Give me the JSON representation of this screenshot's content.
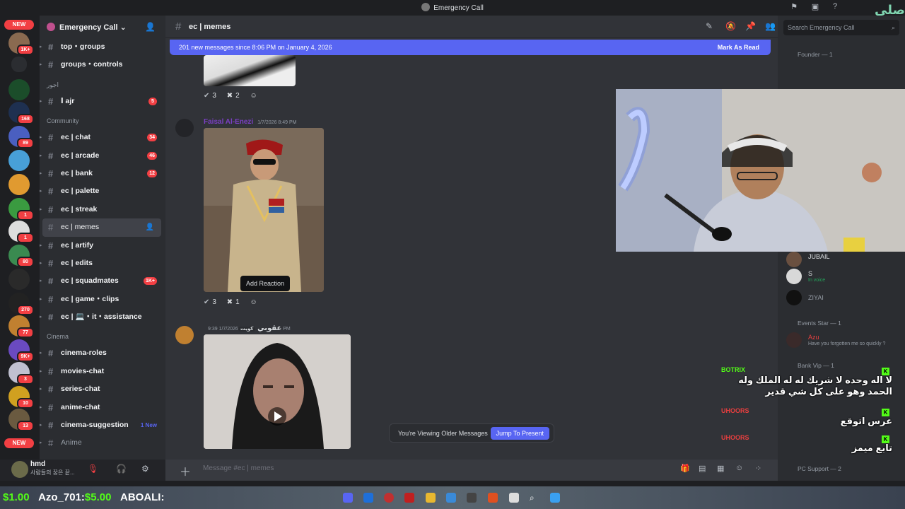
{
  "window": {
    "title": "Emergency Call"
  },
  "server": {
    "name": "Emergency Call"
  },
  "guild_badges": [
    "NEW",
    "1K+",
    "168",
    "89",
    "1",
    "1",
    "80",
    "270",
    "77",
    "9K+",
    "3",
    "10",
    "13",
    "NEW"
  ],
  "channels": [
    {
      "type": "channel",
      "label": "top・groups",
      "unread": true
    },
    {
      "type": "channel",
      "label": "groups・controls",
      "unread": true
    },
    {
      "type": "category",
      "label": "اجور"
    },
    {
      "type": "channel",
      "label": "ا ajr",
      "unread": true,
      "count": "5"
    },
    {
      "type": "category",
      "label": "Community"
    },
    {
      "type": "channel",
      "label": "ec | chat",
      "unread": true,
      "count": "34"
    },
    {
      "type": "channel",
      "label": "ec | arcade",
      "unread": true,
      "count": "46"
    },
    {
      "type": "channel",
      "label": "ec | bank",
      "unread": true,
      "count": "12"
    },
    {
      "type": "channel",
      "label": "ec | palette",
      "unread": true
    },
    {
      "type": "channel",
      "label": "ec | streak",
      "unread": true
    },
    {
      "type": "channel",
      "label": "ec | memes",
      "active": true
    },
    {
      "type": "channel",
      "label": "ec | artify",
      "unread": true
    },
    {
      "type": "channel",
      "label": "ec | edits",
      "unread": true
    },
    {
      "type": "channel",
      "label": "ec | squadmates",
      "unread": true,
      "count": "1K+"
    },
    {
      "type": "channel",
      "label": "ec | game・clips",
      "unread": true
    },
    {
      "type": "channel",
      "label": "ec | 💻・it・assistance",
      "unread": true
    },
    {
      "type": "category",
      "label": "Cinema"
    },
    {
      "type": "channel",
      "label": "cinema-roles",
      "unread": true
    },
    {
      "type": "channel",
      "label": "movies-chat",
      "unread": true
    },
    {
      "type": "channel",
      "label": "series-chat",
      "unread": true
    },
    {
      "type": "channel",
      "label": "anime-chat",
      "unread": true
    },
    {
      "type": "channel",
      "label": "cinema-suggestion",
      "unread": true,
      "newtag": "1 New"
    },
    {
      "type": "channel",
      "label": "Anime"
    }
  ],
  "user": {
    "name": "hmd",
    "status": "사람들의 꿈은 끝..."
  },
  "chat": {
    "channel_name": "ec | memes",
    "banner": "201 new messages since 8:06 PM on January 4, 2026",
    "mark_as_read": "Mark As Read",
    "reactions1": [
      {
        "emoji": "✔",
        "count": "3"
      },
      {
        "emoji": "✖",
        "count": "2"
      }
    ],
    "msg2": {
      "author": "Faisal Al-Enezi",
      "timestamp": "1/7/2026 8:49 PM",
      "author_color": "#7b3fc4"
    },
    "tooltip": "Add Reaction",
    "reactions2": [
      {
        "emoji": "✔",
        "count": "3"
      },
      {
        "emoji": "✖",
        "count": "1"
      }
    ],
    "msg3": {
      "author": "عقوبي",
      "tag": "كويت",
      "timestamp": "1/7/2026 9:39 PM"
    },
    "older_text": "You're Viewing Older Messages",
    "jump_label": "Jump To Present",
    "composer_placeholder": "Message #ec | memes"
  },
  "members": {
    "search_placeholder": "Search Emergency Call",
    "groups": [
      {
        "label": "Founder — 1"
      },
      {
        "label": "Events Star — 1"
      },
      {
        "label": "Bank Vip — 1"
      },
      {
        "label": "PC Support — 2"
      }
    ],
    "items": [
      {
        "name": "JUBAIL",
        "sub": ""
      },
      {
        "name": "S",
        "sub": "In voice"
      },
      {
        "name": "ZIYAI",
        "sub": ""
      },
      {
        "name": "Azu",
        "sub": "Have you forgotten me so quickly ?"
      }
    ]
  },
  "overlay_chat": [
    {
      "who": "BOTRIX",
      "msg": "لا اله وحده لا شريك له له الملك وله الحمد وهو على كل شي قدير"
    },
    {
      "who": "UHOORS",
      "msg": "عرس اتوقع"
    },
    {
      "who": "UHOORS",
      "msg": "تابع ميمز"
    }
  ],
  "overlay_top": "صلي واجي",
  "ticker": {
    "a": "$1.00",
    "b": "Azo_701:",
    "c": "$5.00",
    "d": "ABOALI:"
  },
  "colors": {
    "accent": "#5865f2",
    "danger": "#f23f43",
    "kick": "#53fc18"
  }
}
